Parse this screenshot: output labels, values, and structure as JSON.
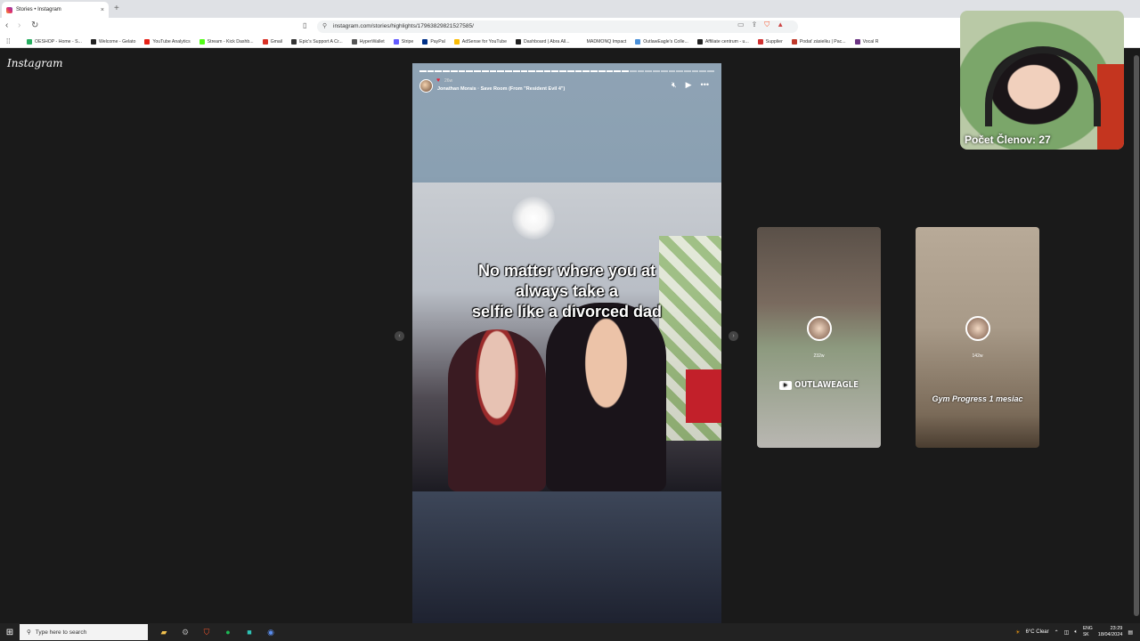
{
  "browser": {
    "tab_title": "Stories • Instagram",
    "tab_close": "×",
    "new_tab": "+",
    "url": "instagram.com/stories/highlights/17963829821527585/",
    "bookmarks": [
      {
        "label": "OESHOP - Home - S...",
        "color": "#27ae60"
      },
      {
        "label": "Welcome - Gelato",
        "color": "#222222"
      },
      {
        "label": "YouTube Analytics",
        "color": "#e62117"
      },
      {
        "label": "Stream - Kick Dashb...",
        "color": "#53fc18"
      },
      {
        "label": "Gmail",
        "color": "#d93025"
      },
      {
        "label": "Epic's Support A Cr...",
        "color": "#333333"
      },
      {
        "label": "HyperWallet",
        "color": "#555555"
      },
      {
        "label": "Stripe",
        "color": "#635bff"
      },
      {
        "label": "PayPal",
        "color": "#003087"
      },
      {
        "label": "AdSense for YouTube",
        "color": "#fbbc04"
      },
      {
        "label": "Dashboard | Abra All...",
        "color": "#222222"
      },
      {
        "label": "MADMONQ Impact",
        "color": "#ffffff"
      },
      {
        "label": "OutlawEagle's Colle...",
        "color": "#4a90d9"
      },
      {
        "label": "Affiliate centrum - u...",
        "color": "#222222"
      },
      {
        "label": "Supplier",
        "color": "#d03030"
      },
      {
        "label": "Podať zásielku | Pac...",
        "color": "#c0392b"
      },
      {
        "label": "Vocal R",
        "color": "#6c3483"
      }
    ]
  },
  "instagram": {
    "logo": "Instagram",
    "story": {
      "time": "26w",
      "song": "Jonathan Morais · Save Room (From \"Resident Evil 4\")",
      "caption_lines": [
        "No matter where you at",
        "always take a",
        "selfie like a divorced dad"
      ],
      "progress_total": 38,
      "progress_done": 27
    },
    "thumbs": [
      {
        "time": "232w",
        "label": "OUTLAWEAGLE"
      },
      {
        "time": "142w",
        "label": "Gym Progress 1 mesiac"
      }
    ]
  },
  "webcam": {
    "viewers": "Počet Členov: 27"
  },
  "taskbar": {
    "search_placeholder": "Type here to search",
    "weather": "6°C  Clear",
    "lang_1": "ENG",
    "lang_2": "SK",
    "time": "23:29",
    "date": "18/04/2024"
  }
}
